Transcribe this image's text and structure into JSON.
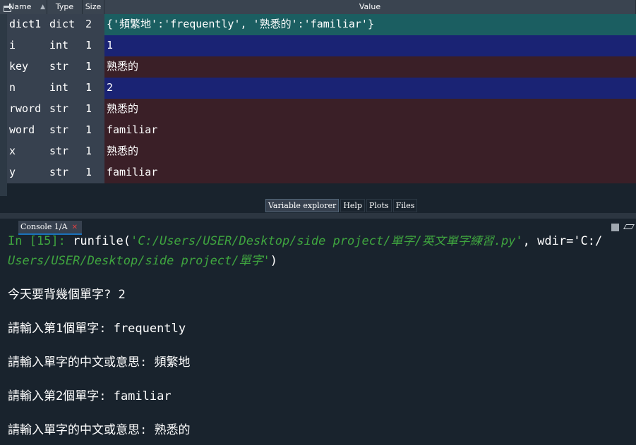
{
  "variable_explorer": {
    "columns": {
      "name": "Name",
      "type": "Type",
      "size": "Size",
      "value": "Value"
    },
    "rows": [
      {
        "name": "dict1",
        "type": "dict",
        "size": "2",
        "value": "{'頻繁地':'frequently', '熟悉的':'familiar'}",
        "kind": "dict"
      },
      {
        "name": "i",
        "type": "int",
        "size": "1",
        "value": "1",
        "kind": "int"
      },
      {
        "name": "key",
        "type": "str",
        "size": "1",
        "value": "熟悉的",
        "kind": "str"
      },
      {
        "name": "n",
        "type": "int",
        "size": "1",
        "value": "2",
        "kind": "int"
      },
      {
        "name": "rword",
        "type": "str",
        "size": "1",
        "value": "熟悉的",
        "kind": "str"
      },
      {
        "name": "word",
        "type": "str",
        "size": "1",
        "value": "familiar",
        "kind": "str"
      },
      {
        "name": "x",
        "type": "str",
        "size": "1",
        "value": "熟悉的",
        "kind": "str"
      },
      {
        "name": "y",
        "type": "str",
        "size": "1",
        "value": "familiar",
        "kind": "str"
      }
    ],
    "pane_tabs": [
      "Variable explorer",
      "Help",
      "Plots",
      "Files"
    ]
  },
  "console": {
    "tab_label": "Console 1/A",
    "close_glyph": "✕",
    "run_line": {
      "prompt": "In [15]: ",
      "call": "runfile(",
      "path": "'C:/Users/USER/Desktop/side project/單字/英文單字練習.py'",
      "wdir_label": ", wdir='C:/"
    },
    "run_line2": "Users/USER/Desktop/side project/單字'",
    "run_line2_end": ")",
    "output": [
      "今天要背幾個單字? 2",
      "請輸入第1個單字: frequently",
      "請輸入單字的中文或意思: 頻繁地",
      "請輸入第2個單字: familiar",
      "請輸入單字的中文或意思: 熟悉的"
    ]
  },
  "colors": {
    "background": "#19232d",
    "dict_row": "#1b5e61",
    "int_row": "#1a2374",
    "str_row": "#3a1f27",
    "prompt_green": "#3fa53f"
  }
}
